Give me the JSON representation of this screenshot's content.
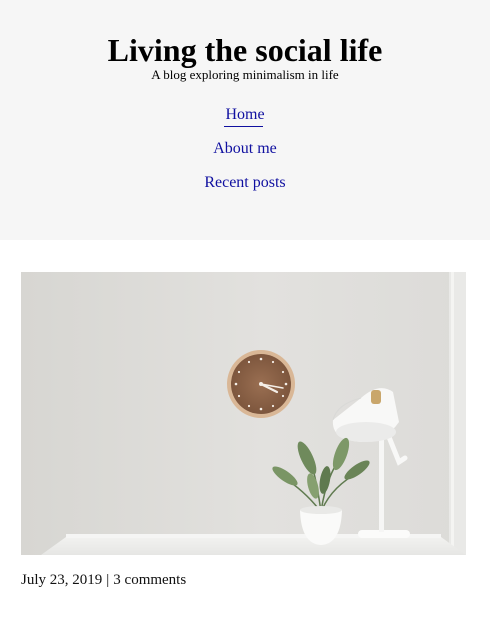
{
  "site": {
    "title": "Living the social life",
    "tagline": "A blog exploring minimalism in life"
  },
  "nav": {
    "items": [
      {
        "label": "Home"
      },
      {
        "label": "About me"
      },
      {
        "label": "Recent posts"
      }
    ]
  },
  "post": {
    "date": "July 23, 2019",
    "separator": "|",
    "comments": "3 comments"
  },
  "colors": {
    "header_bg": "#f6f6f6",
    "link": "#1010a0"
  },
  "icons": {
    "featured_image": "wall-clock-plant-lamp-photo"
  }
}
